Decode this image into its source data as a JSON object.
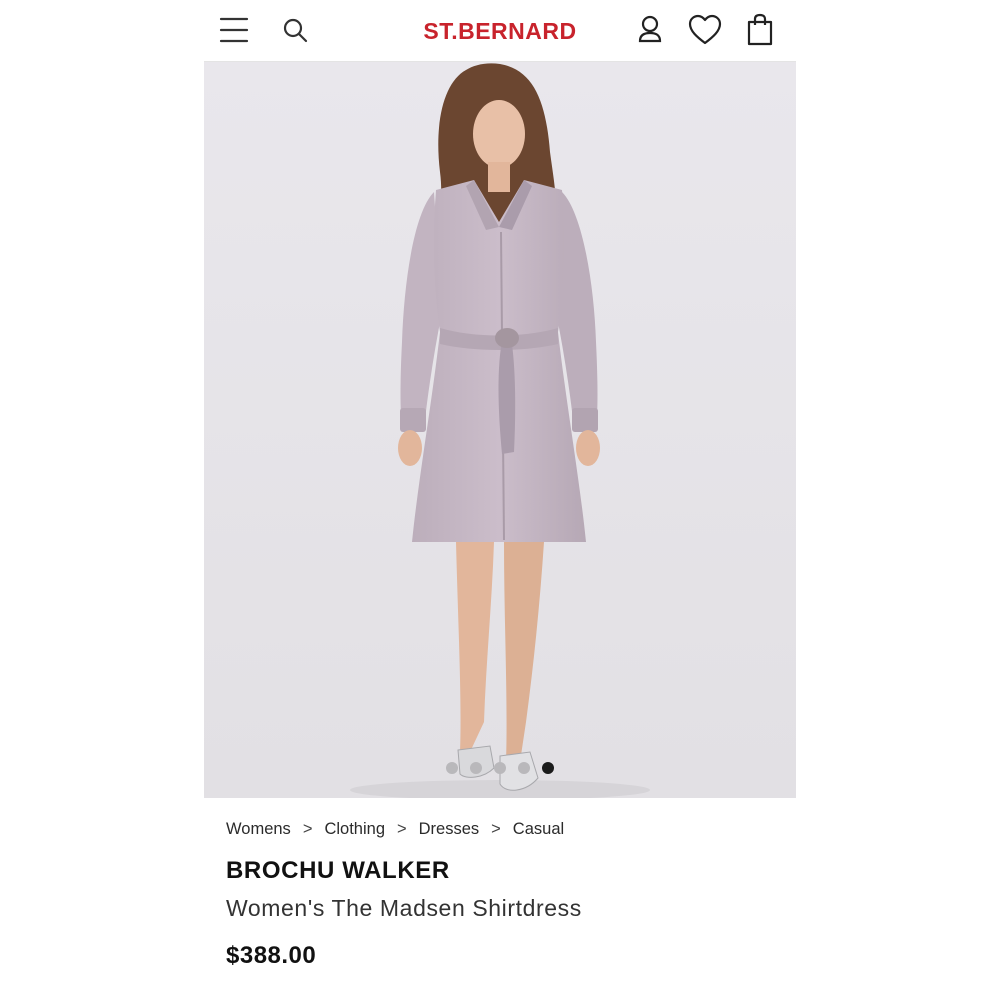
{
  "header": {
    "logo": "ST.BERNARD",
    "icons": {
      "menu": "hamburger-menu-icon",
      "search": "search-icon",
      "account": "user-icon",
      "wishlist": "heart-icon",
      "cart": "shopping-bag-icon"
    },
    "brand_color": "#c8232c"
  },
  "gallery": {
    "image_count": 5,
    "active_index": 4
  },
  "breadcrumb": {
    "items": [
      "Womens",
      "Clothing",
      "Dresses",
      "Casual"
    ],
    "separator": ">"
  },
  "product": {
    "brand": "BROCHU WALKER",
    "title": "Women's The Madsen Shirtdress",
    "price": "$388.00"
  }
}
